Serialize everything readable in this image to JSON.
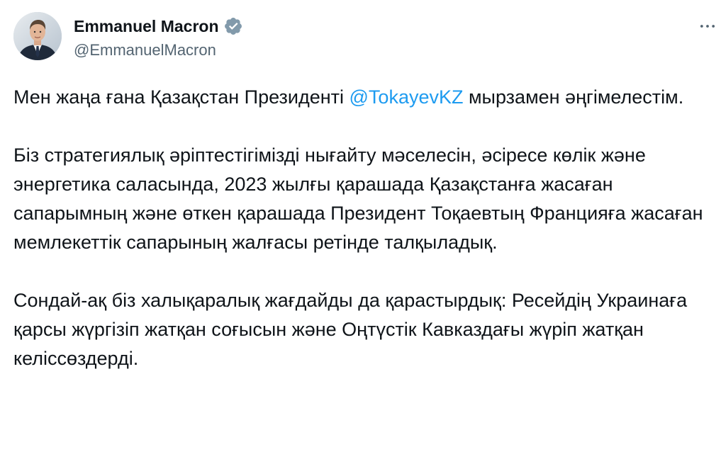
{
  "author": {
    "display_name": "Emmanuel Macron",
    "handle": "@EmmanuelMacron",
    "verified_icon": "verified-badge-icon",
    "avatar_icon": "profile-photo"
  },
  "more_icon": "more-horizontal-icon",
  "tweet": {
    "p1_before": "Мен жаңа ғана Қазақстан Президенті ",
    "p1_mention": "@TokayevKZ",
    "p1_after": " мырзамен әңгімелестім.",
    "p2": "Біз стратегиялық әріптестігімізді нығайту мәселесін, әсіресе көлік және энергетика саласында, 2023 жылғы қарашада Қазақстанға жасаған сапарымның және өткен қарашада Президент Тоқаевтың Францияға жасаған мемлекеттік сапарының жалғасы ретінде талқыладық.",
    "p3": "Сондай-ақ біз халықаралық жағдайды да қарастырдық: Ресейдің Украинаға қарсы жүргізіп жатқан соғысын және Оңтүстік Кавказдағы жүріп жатқан келіссөздерді."
  },
  "colors": {
    "text": "#0f1419",
    "secondary": "#536471",
    "link": "#1d9bf0",
    "verified_badge": "#829aab"
  }
}
